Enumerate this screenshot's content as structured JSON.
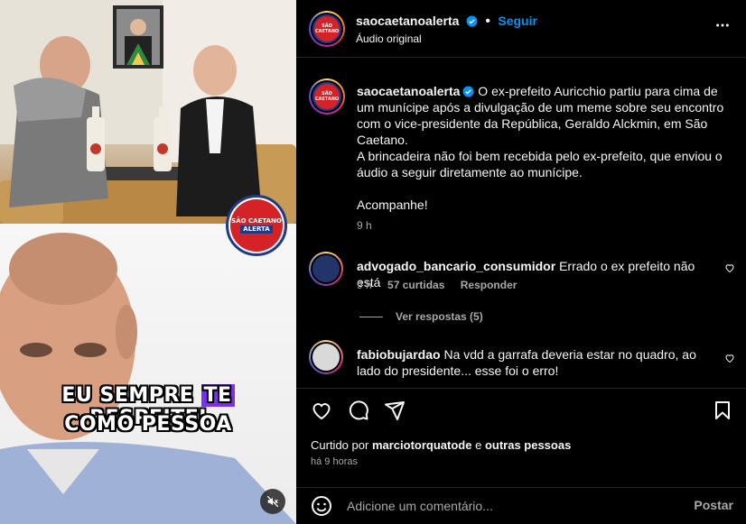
{
  "colors": {
    "accent": "#0095f6",
    "muted": "#a8a8a8",
    "caption_highlight": "#7b2ff0"
  },
  "media": {
    "watermark_top": "SÃO CAETANO",
    "watermark_bottom": "ALERTA",
    "caption_line1_a": "EU SEMPRE",
    "caption_line1_highlight": "TE",
    "caption_line1_b": "RESPEITEI",
    "caption_line2": "COMO PESSOA",
    "mute_icon": "speaker-muted-icon"
  },
  "header": {
    "username": "saocaetanoalerta",
    "separator": "•",
    "follow_label": "Seguir",
    "subtitle": "Áudio original",
    "more_icon": "more-options-icon"
  },
  "post": {
    "username": "saocaetanoalerta",
    "caption_p1": "O ex-prefeito Auricchio partiu para cima de um munícipe após a divulgação de um meme sobre seu encontro com o vice-presidente da República, Geraldo Alckmin, em São Caetano.",
    "caption_p2": "A brincadeira não foi bem recebida pelo ex-prefeito, que enviou o áudio a seguir diretamente ao munícipe.",
    "caption_p3": "Acompanhe!",
    "time": "9 h"
  },
  "comments": [
    {
      "username": "advogado_bancario_consumidor",
      "text": "Errado o ex prefeito não está",
      "time": "9 h",
      "likes": "57 curtidas",
      "reply_label": "Responder",
      "view_replies": "Ver respostas (5)"
    },
    {
      "username": "fabiobujardao",
      "text": "Na vdd a garrafa deveria estar no quadro, ao lado do presidente... esse foi o erro!"
    }
  ],
  "actions": {
    "like_icon": "heart-icon",
    "comment_icon": "comment-icon",
    "share_icon": "share-icon",
    "save_icon": "bookmark-icon",
    "liked_prefix": "Curtido por",
    "liked_user": "marciotorquatode",
    "liked_conj": "e",
    "liked_others": "outras pessoas",
    "time_ago": "há 9 horas"
  },
  "add_comment": {
    "emoji_icon": "emoji-icon",
    "placeholder": "Adicione um comentário...",
    "post_label": "Postar"
  }
}
